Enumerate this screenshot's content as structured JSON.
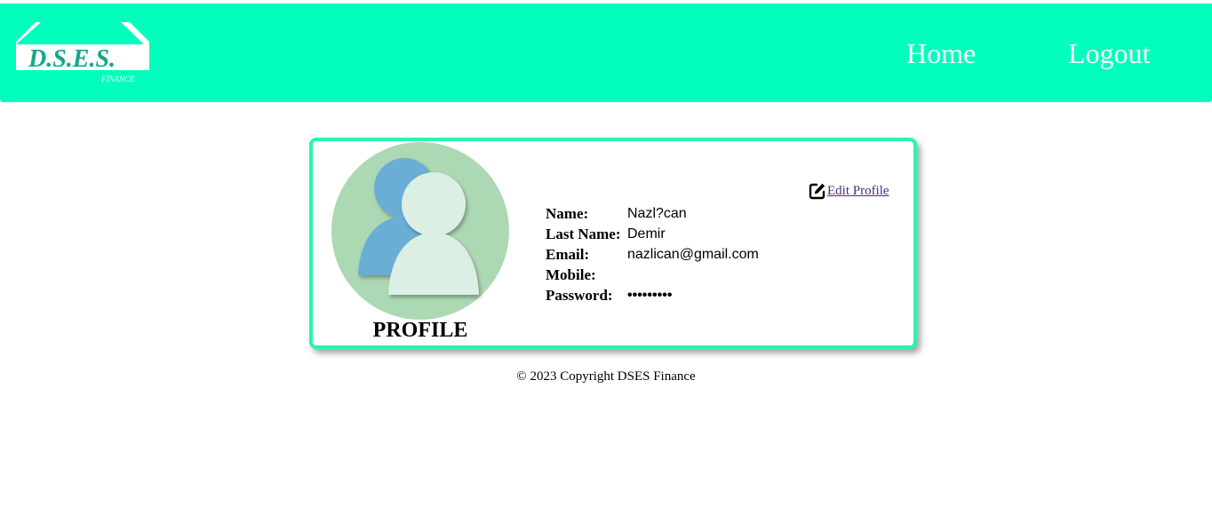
{
  "header": {
    "logo_text": "D.S.E.S.",
    "logo_subtext": "FINANCE",
    "nav": {
      "home": "Home",
      "logout": "Logout"
    }
  },
  "profile": {
    "heading": "PROFILE",
    "edit_label": "Edit Profile",
    "fields": [
      {
        "label": "Name:",
        "value": "Nazl?can"
      },
      {
        "label": "Last Name:",
        "value": "Demir"
      },
      {
        "label": "Email:",
        "value": "nazlican@gmail.com"
      },
      {
        "label": "Mobile:",
        "value": ""
      },
      {
        "label": "Password:",
        "value": "•••••••••"
      }
    ]
  },
  "footer": {
    "text": "© 2023 Copyright DSES Finance"
  },
  "colors": {
    "navbar": "#00ffbd",
    "card_border": "#29f5ad",
    "avatar_circle": "#acd9b3",
    "avatar_back": "#6aaed6",
    "avatar_front": "#dcefe4",
    "logo_text": "#12a78a"
  },
  "icons": {
    "edit": "edit-square-icon",
    "avatar": "users-icon"
  }
}
